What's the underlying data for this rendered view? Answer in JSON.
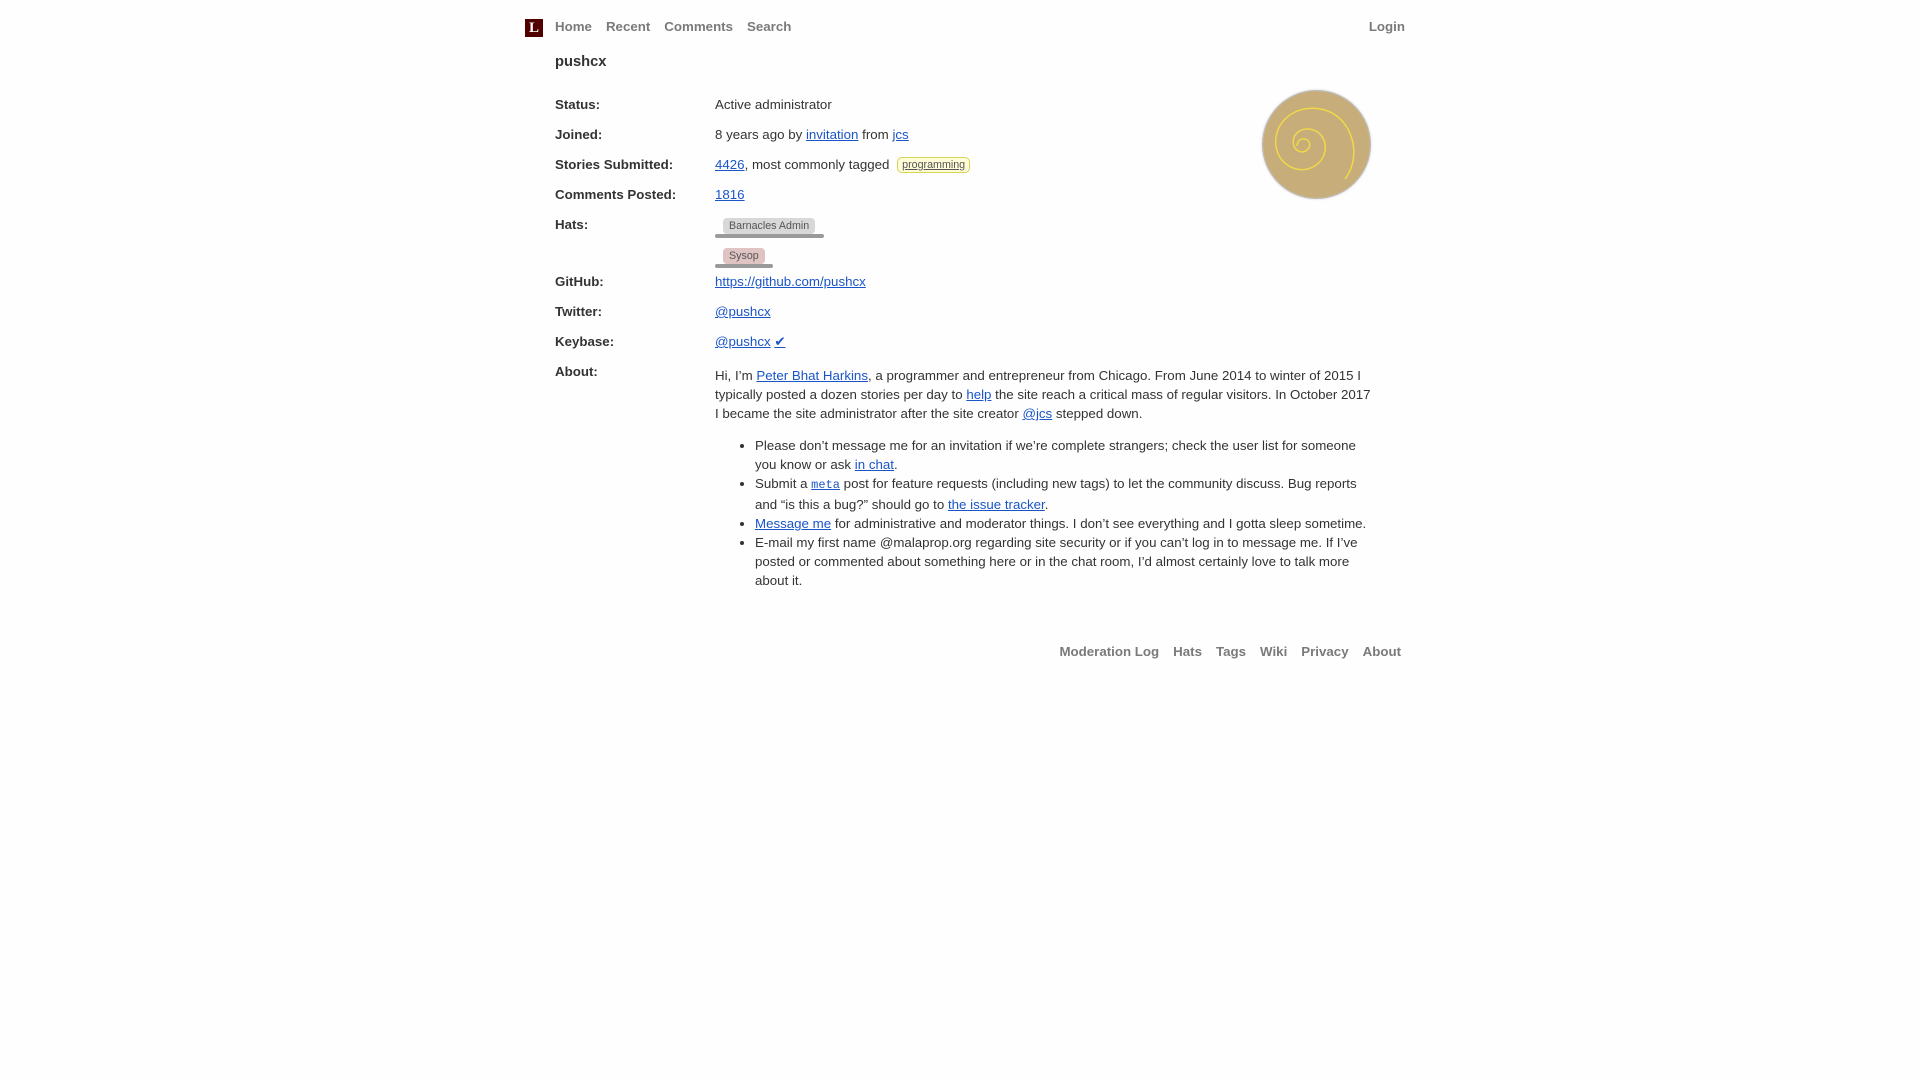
{
  "header": {
    "logo": "L",
    "nav": [
      "Home",
      "Recent",
      "Comments",
      "Search"
    ],
    "login": "Login"
  },
  "profile": {
    "username": "pushcx",
    "status_label": "Status:",
    "status": "Active administrator",
    "joined_label": "Joined:",
    "joined_ago": "8 years ago",
    "joined_by": "by",
    "joined_invitation": "invitation",
    "joined_from": "from",
    "joined_inviter": "jcs",
    "stories_label": "Stories Submitted:",
    "stories_count": "4426",
    "stories_text": ", most commonly tagged",
    "stories_tag": "programming",
    "comments_label": "Comments Posted:",
    "comments_count": "1816",
    "hats_label": "Hats:",
    "hats": [
      "Barnacles Admin",
      "Sysop"
    ],
    "github_label": "GitHub:",
    "github": "https://github.com/pushcx",
    "twitter_label": "Twitter:",
    "twitter": "@pushcx",
    "keybase_label": "Keybase:",
    "keybase": "@pushcx",
    "keybase_check": "✔",
    "about_label": "About:"
  },
  "about": {
    "p1_a": "Hi, I’m ",
    "p1_link1": "Peter Bhat Harkins",
    "p1_b": ", a programmer and entrepreneur from Chicago. From June 2014 to winter of 2015 I typically posted a dozen stories per day to ",
    "p1_link2": "help",
    "p1_c": " the site reach a critical mass of regular visitors. In October 2017 I became the site administrator after the site creator ",
    "p1_link3": "@jcs",
    "p1_d": " stepped down.",
    "li1_a": "Please don’t message me for an invitation if we’re complete strangers; check the user list for someone you know or ask ",
    "li1_link": "in chat",
    "li1_b": ".",
    "li2_a": "Submit a ",
    "li2_code": "meta",
    "li2_b": " post for feature requests (including new tags) to let the community discuss. Bug reports and “is this a bug?” should go to ",
    "li2_link": "the issue tracker",
    "li2_c": ".",
    "li3_link": "Message me",
    "li3_a": " for administrative and moderator things. I don’t see everything and I gotta sleep sometime.",
    "li4": "E-mail my first name @malaprop.org regarding site security or if you can’t log in to message me. If I’ve posted or commented about something here or in the chat room, I’d almost certainly love to talk more about it."
  },
  "footer": [
    "Moderation Log",
    "Hats",
    "Tags",
    "Wiki",
    "Privacy",
    "About"
  ],
  "colors": {
    "logo_bg": "#500000",
    "link": "#1a55c8",
    "nav": "#7a7a7a",
    "tag_bg": "#fffcd7",
    "avatar_bg": "#c6ad7a",
    "avatar_spiral": "#f0d84a"
  }
}
